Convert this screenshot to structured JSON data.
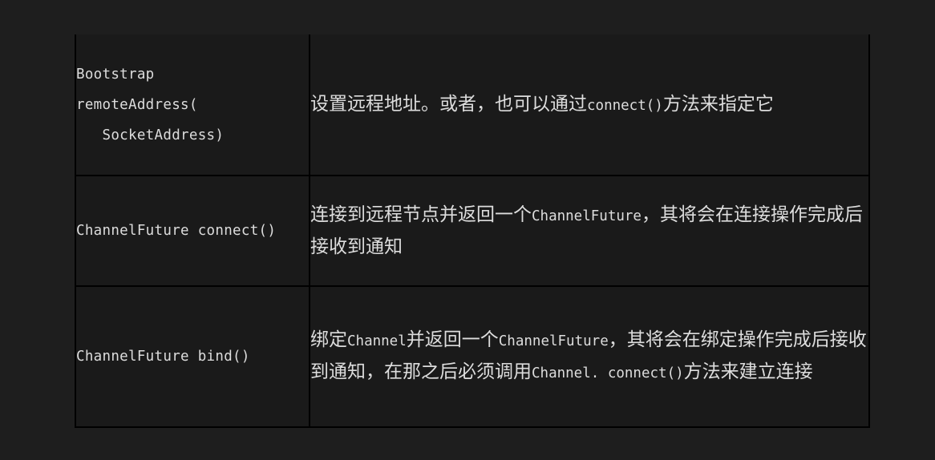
{
  "rows": [
    {
      "signature_lines": [
        "Bootstrap",
        "remoteAddress(",
        "   SocketAddress)"
      ],
      "description_parts": [
        {
          "text": "设置远程地址。或者，也可以通过",
          "code": false
        },
        {
          "text": "connect()",
          "code": true
        },
        {
          "text": "方法来指定它",
          "code": false
        }
      ]
    },
    {
      "signature_lines": [
        "ChannelFuture connect()"
      ],
      "description_parts": [
        {
          "text": "连接到远程节点并返回一个",
          "code": false
        },
        {
          "text": "ChannelFuture",
          "code": true
        },
        {
          "text": "，其将会在连接操作完成后接收到通知",
          "code": false
        }
      ]
    },
    {
      "signature_lines": [
        "ChannelFuture bind()"
      ],
      "description_parts": [
        {
          "text": "绑定",
          "code": false
        },
        {
          "text": "Channel",
          "code": true
        },
        {
          "text": "并返回一个",
          "code": false
        },
        {
          "text": "ChannelFuture",
          "code": true
        },
        {
          "text": "，其将会在绑定操作完成后接收到通知，在那之后必须调用",
          "code": false
        },
        {
          "text": "Channel. connect()",
          "code": true
        },
        {
          "text": "方法来建立连接",
          "code": false
        }
      ]
    }
  ]
}
